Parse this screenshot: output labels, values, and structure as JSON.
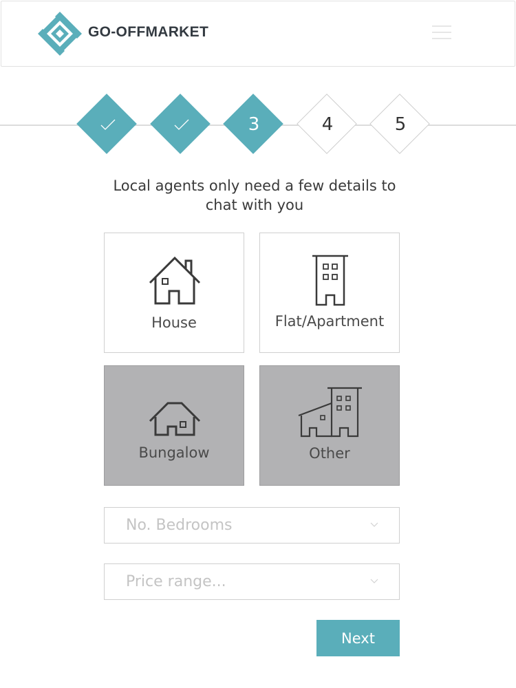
{
  "header": {
    "brand": "GO-OFFMARKET",
    "logo_icon": "diamond-logo-icon",
    "menu_icon": "hamburger-menu-icon"
  },
  "progress": {
    "steps": [
      {
        "label": "",
        "state": "done",
        "icon": "check-icon"
      },
      {
        "label": "",
        "state": "done",
        "icon": "check-icon"
      },
      {
        "label": "3",
        "state": "current"
      },
      {
        "label": "4",
        "state": "todo"
      },
      {
        "label": "5",
        "state": "todo"
      }
    ]
  },
  "intro": {
    "line1": "Local agents only need a few details to",
    "line2": "chat with you"
  },
  "property_types": [
    {
      "label": "House",
      "icon": "house-icon",
      "selected": false
    },
    {
      "label": "Flat/Apartment",
      "icon": "apartment-building-icon",
      "selected": false
    },
    {
      "label": "Bungalow",
      "icon": "bungalow-icon",
      "selected": true
    },
    {
      "label": "Other",
      "icon": "other-buildings-icon",
      "selected": true
    }
  ],
  "bedrooms": {
    "placeholder": "No. Bedrooms"
  },
  "price": {
    "placeholder": "Price range..."
  },
  "next_label": "Next",
  "colors": {
    "accent": "#5aaeba",
    "selected_card": "#b2b2b4",
    "text": "#333a41"
  }
}
